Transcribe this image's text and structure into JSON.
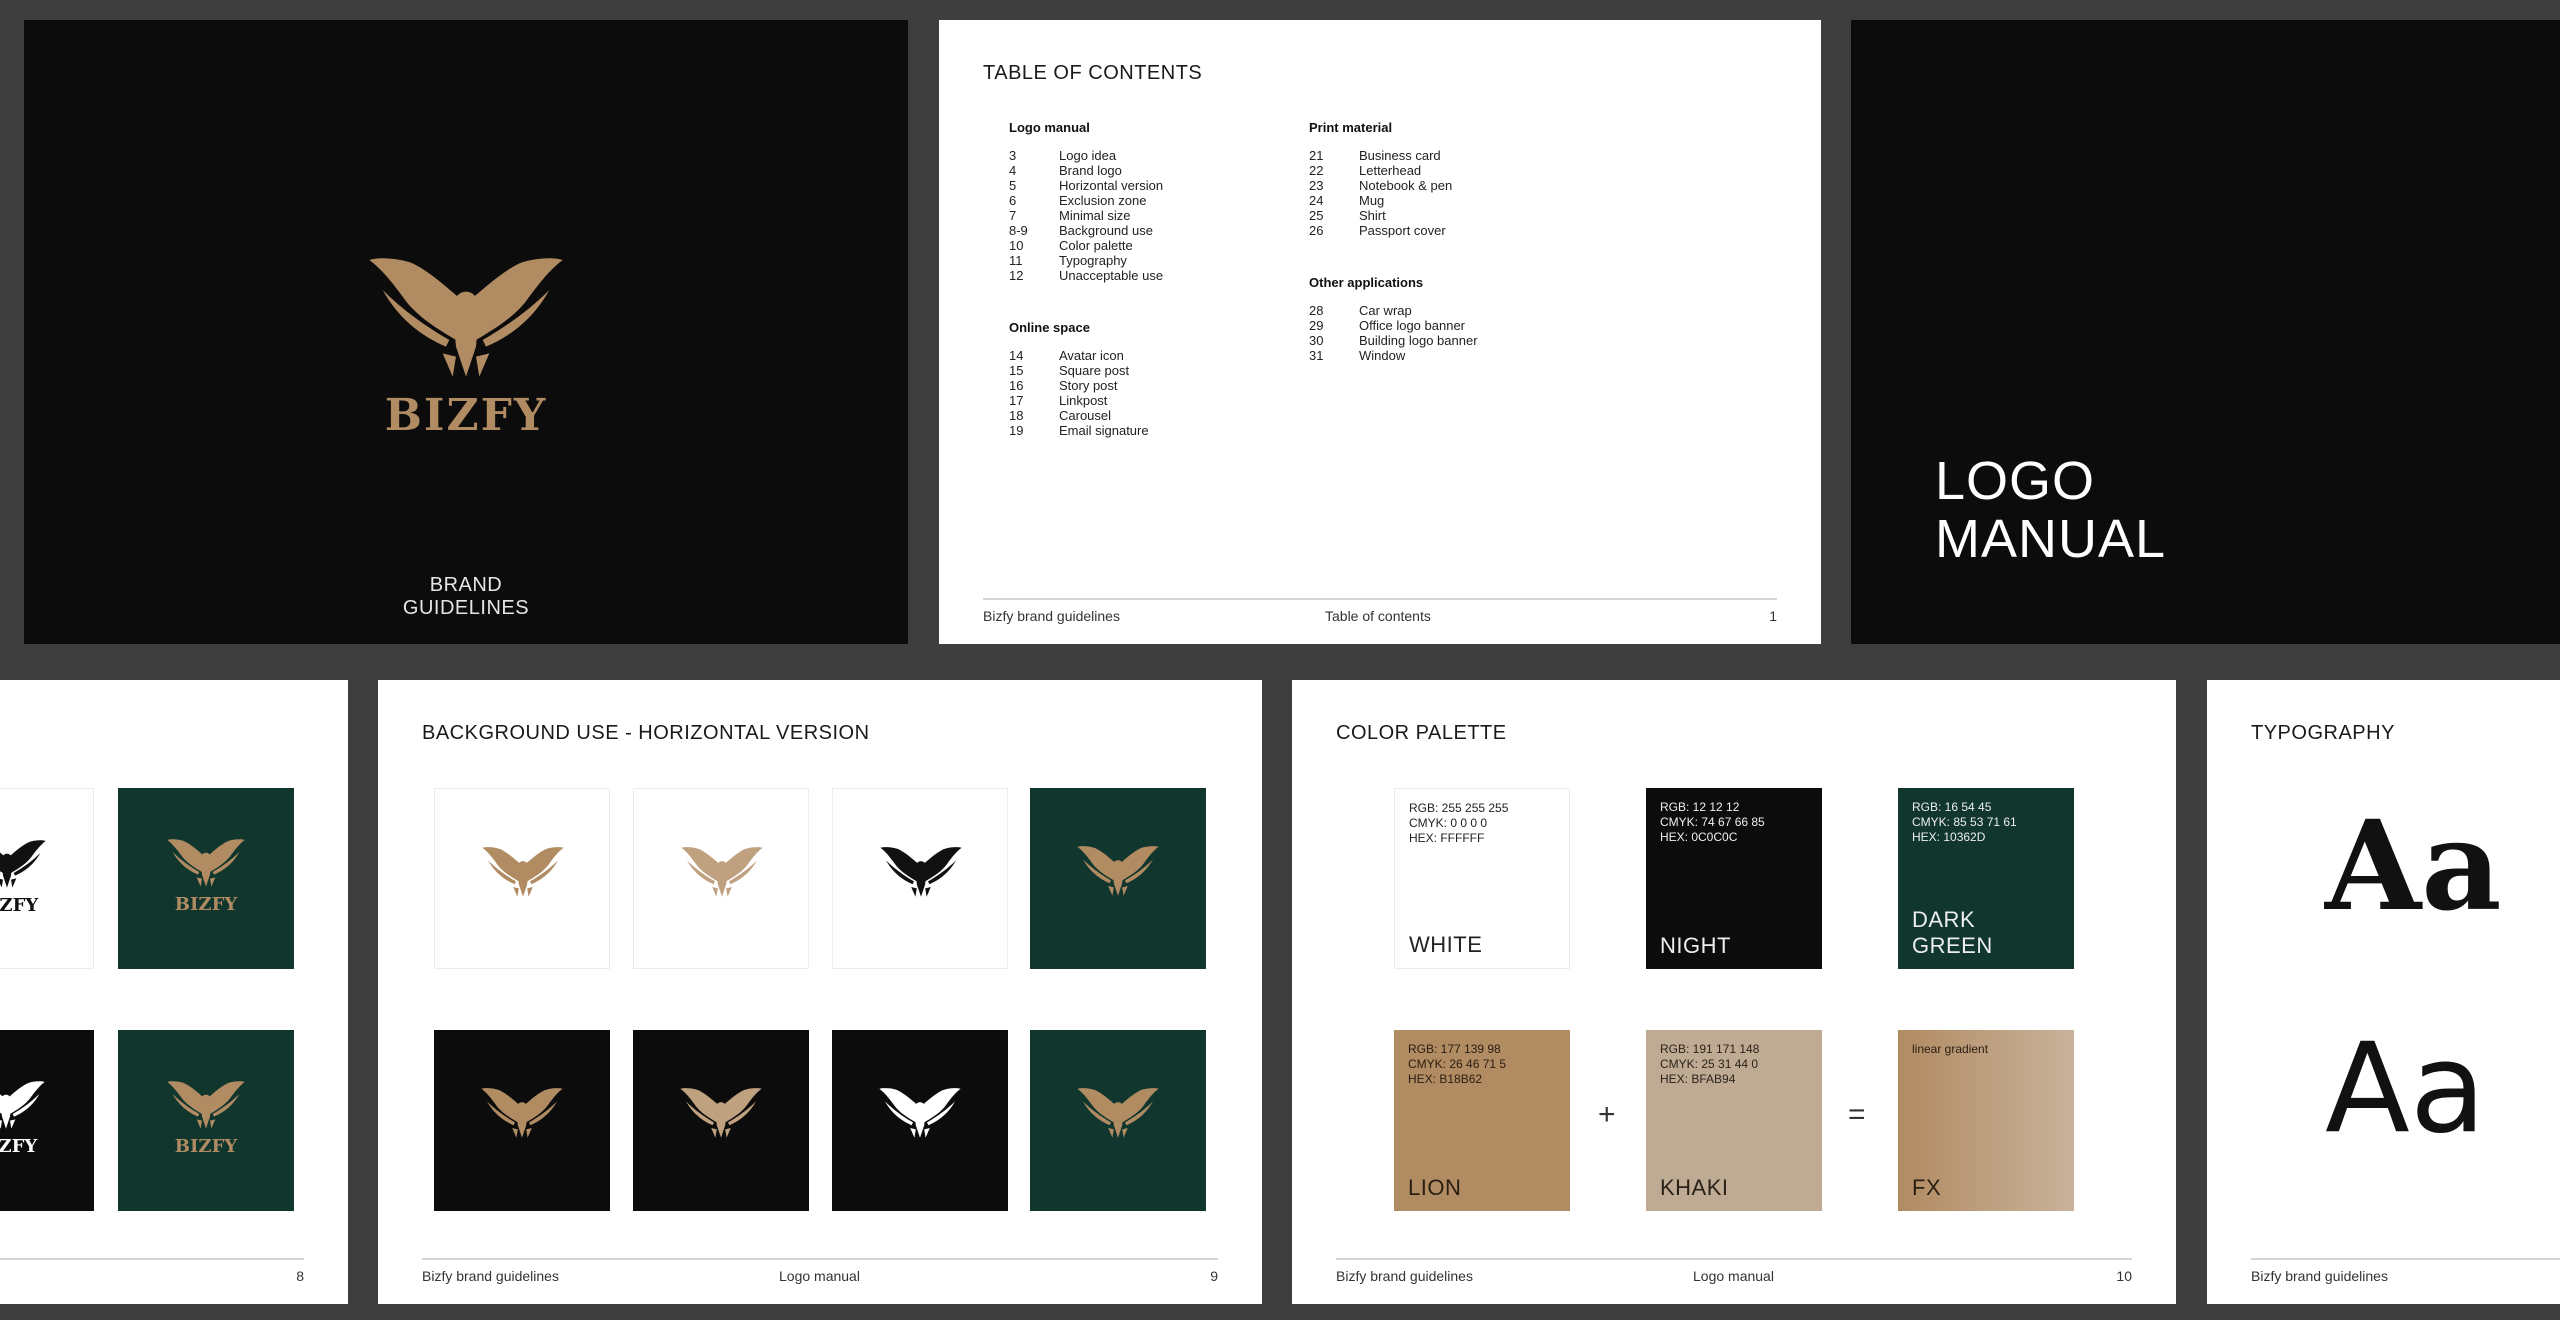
{
  "colors": {
    "background": "#3e3e3e",
    "night": "#0c0c0c",
    "lion": "#b18b62",
    "khaki": "#bfab94",
    "dark_green": "#10362d",
    "white": "#ffffff"
  },
  "cover": {
    "brand": "BIZFY",
    "caption": "BRAND GUIDELINES",
    "logo_icon": "eagle-logo-icon"
  },
  "toc": {
    "title": "TABLE OF CONTENTS",
    "sections": [
      {
        "heading": "Logo manual",
        "items": [
          {
            "n": "3",
            "t": "Logo idea"
          },
          {
            "n": "4",
            "t": "Brand logo"
          },
          {
            "n": "5",
            "t": "Horizontal version"
          },
          {
            "n": "6",
            "t": "Exclusion zone"
          },
          {
            "n": "7",
            "t": "Minimal size"
          },
          {
            "n": "8-9",
            "t": "Background use"
          },
          {
            "n": "10",
            "t": "Color palette"
          },
          {
            "n": "11",
            "t": "Typography"
          },
          {
            "n": "12",
            "t": "Unacceptable use"
          }
        ]
      },
      {
        "heading": "Online space",
        "items": [
          {
            "n": "14",
            "t": "Avatar icon"
          },
          {
            "n": "15",
            "t": "Square post"
          },
          {
            "n": "16",
            "t": "Story post"
          },
          {
            "n": "17",
            "t": "Linkpost"
          },
          {
            "n": "18",
            "t": "Carousel"
          },
          {
            "n": "19",
            "t": "Email signature"
          }
        ]
      },
      {
        "heading": "Print material",
        "items": [
          {
            "n": "21",
            "t": "Business card"
          },
          {
            "n": "22",
            "t": "Letterhead"
          },
          {
            "n": "23",
            "t": "Notebook & pen"
          },
          {
            "n": "24",
            "t": "Mug"
          },
          {
            "n": "25",
            "t": "Shirt"
          },
          {
            "n": "26",
            "t": "Passport cover"
          }
        ]
      },
      {
        "heading": "Other applications",
        "items": [
          {
            "n": "28",
            "t": "Car wrap"
          },
          {
            "n": "29",
            "t": "Office logo banner"
          },
          {
            "n": "30",
            "t": "Building logo banner"
          },
          {
            "n": "31",
            "t": "Window"
          }
        ]
      }
    ],
    "footer_left": "Bizfy brand guidelines",
    "footer_center": "Table of contents",
    "footer_right": "1"
  },
  "section_cover": {
    "line1": "LOGO",
    "line2": "MANUAL"
  },
  "page8": {
    "brand": "BIZFY",
    "page": "8"
  },
  "page9": {
    "title": "BACKGROUND USE - HORIZONTAL VERSION",
    "footer_left": "Bizfy brand guidelines",
    "footer_center": "Logo manual",
    "footer_right": "9"
  },
  "palette": {
    "title": "COLOR PALETTE",
    "white": {
      "rgb": "RGB: 255 255 255",
      "cmyk": "CMYK: 0 0 0 0",
      "hex": "HEX: FFFFFF",
      "name": "WHITE"
    },
    "night": {
      "rgb": "RGB: 12 12 12",
      "cmyk": "CMYK: 74 67 66 85",
      "hex": "HEX: 0C0C0C",
      "name": "NIGHT"
    },
    "green": {
      "rgb": "RGB: 16 54 45",
      "cmyk": "CMYK: 85 53 71 61",
      "hex": "HEX: 10362D",
      "name1": "DARK",
      "name2": "GREEN"
    },
    "lion": {
      "rgb": "RGB: 177 139 98",
      "cmyk": "CMYK: 26 46 71 5",
      "hex": "HEX: B18B62",
      "name": "LION"
    },
    "khaki": {
      "rgb": "RGB: 191 171 148",
      "cmyk": "CMYK: 25 31 44 0",
      "hex": "HEX: BFAB94",
      "name": "KHAKI"
    },
    "fx": {
      "spec": "linear gradient",
      "name": "FX"
    },
    "plus": "+",
    "equals": "=",
    "footer_left": "Bizfy brand guidelines",
    "footer_center": "Logo manual",
    "footer_right": "10"
  },
  "typography": {
    "title": "TYPOGRAPHY",
    "sample_serif": "Aa",
    "sample_sans": "Aa",
    "footer_left": "Bizfy brand guidelines"
  }
}
